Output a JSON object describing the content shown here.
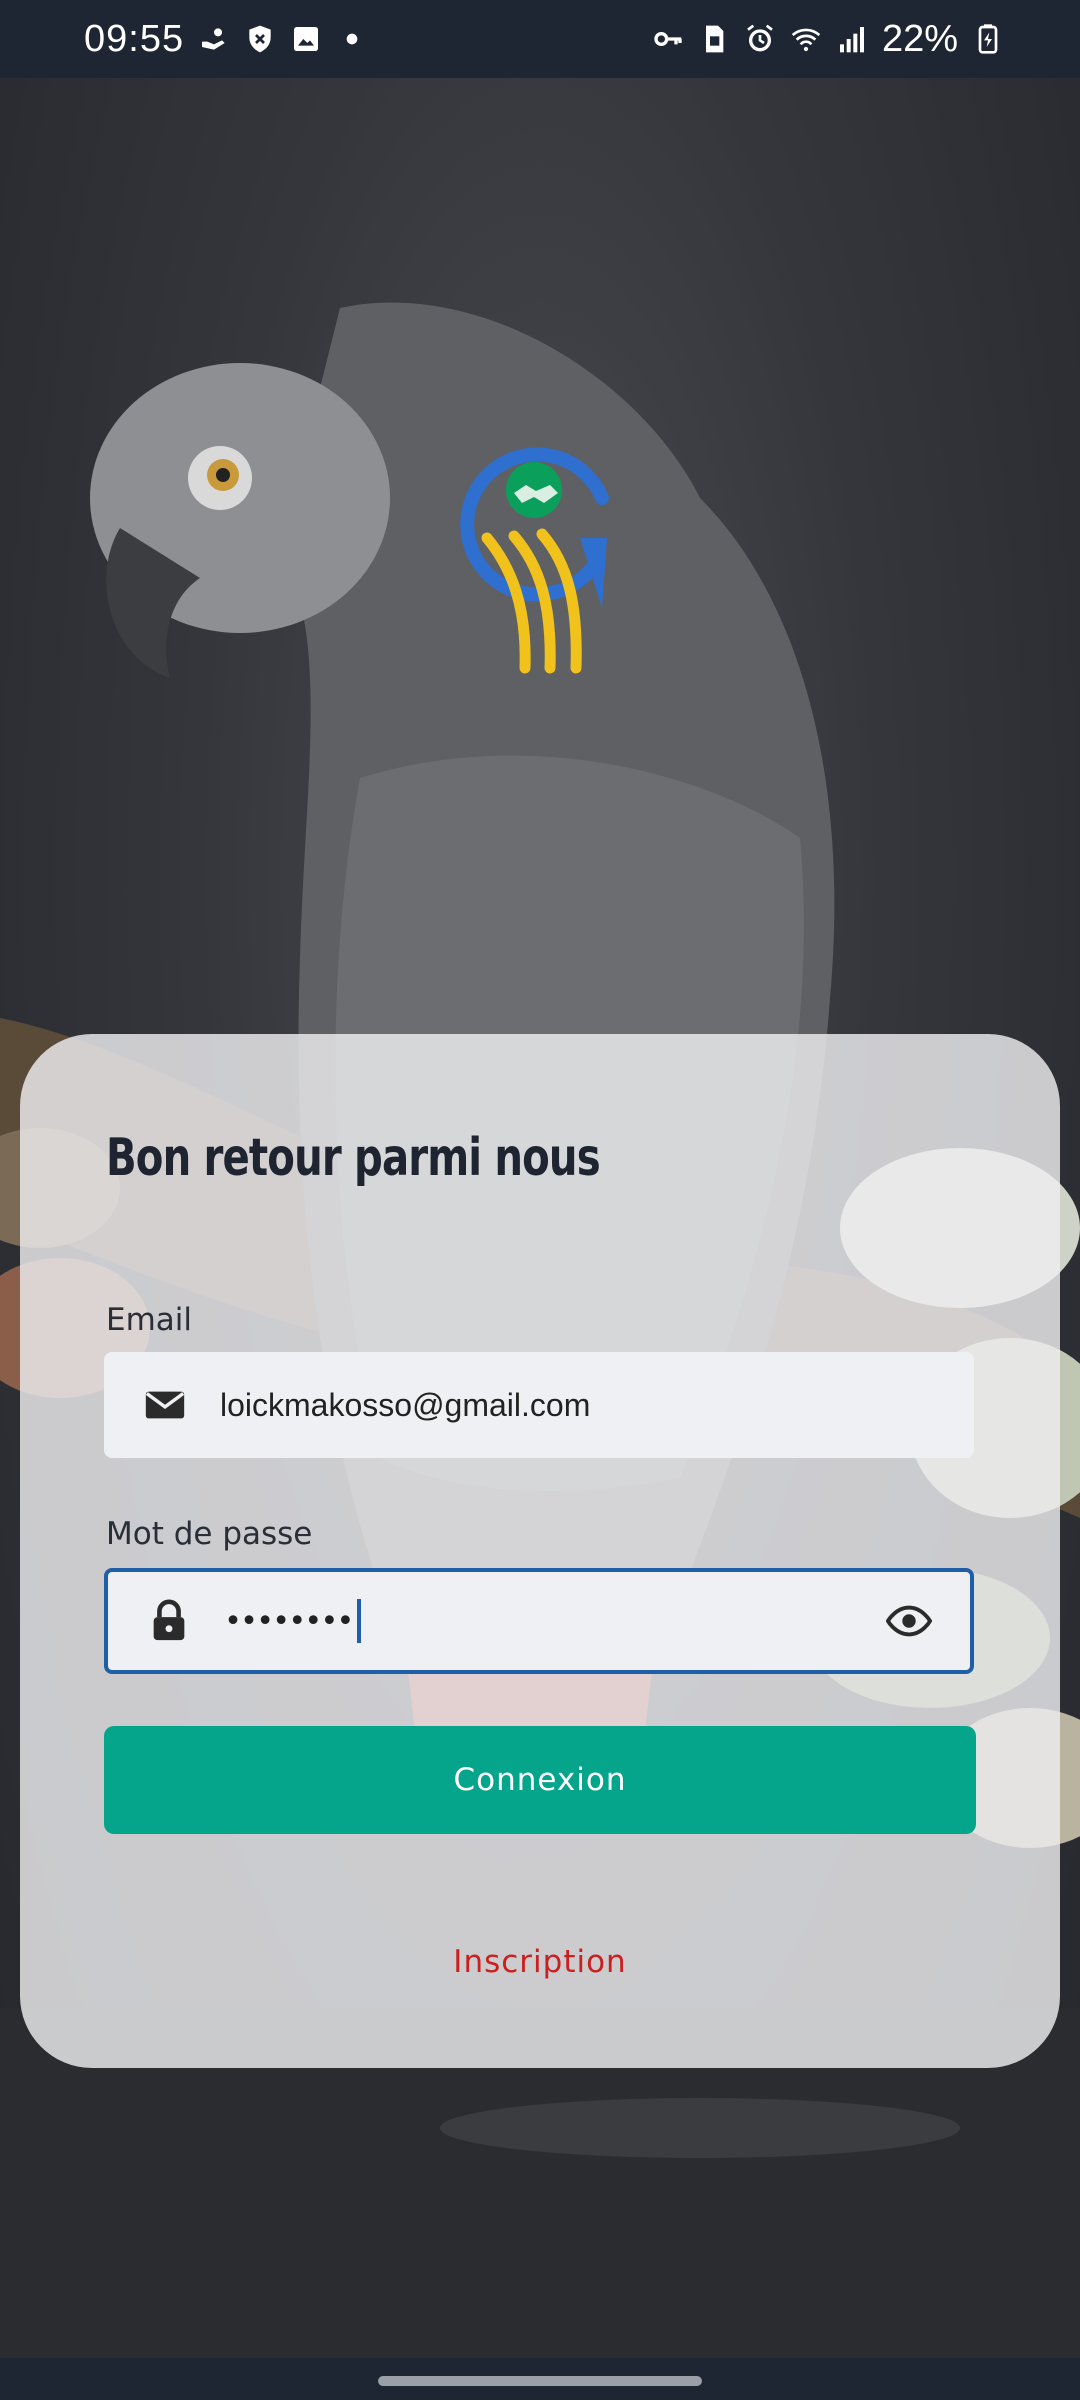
{
  "status_bar": {
    "time": "09:55",
    "battery": "22%",
    "icons_left": [
      "hand-coin-icon",
      "shield-icon",
      "image-icon",
      "dot-icon"
    ],
    "icons_right": [
      "key-icon",
      "sim-card-icon",
      "alarm-icon",
      "wifi-icon",
      "signal-icon",
      "battery-charging-icon"
    ]
  },
  "login": {
    "title": "Bon retour parmi nous",
    "email_label": "Email",
    "email_value": "loickmakosso@gmail.com",
    "password_label": "Mot de passe",
    "password_value": "••••••••",
    "submit_label": "Connexion",
    "signup_label": "Inscription"
  },
  "colors": {
    "accent": "#04a58a",
    "link": "#cc1f1f",
    "focus": "#1f5fa8",
    "logo_blue": "#2f6fd0",
    "logo_yellow": "#f1c21b",
    "logo_green": "#0b9f5c"
  }
}
